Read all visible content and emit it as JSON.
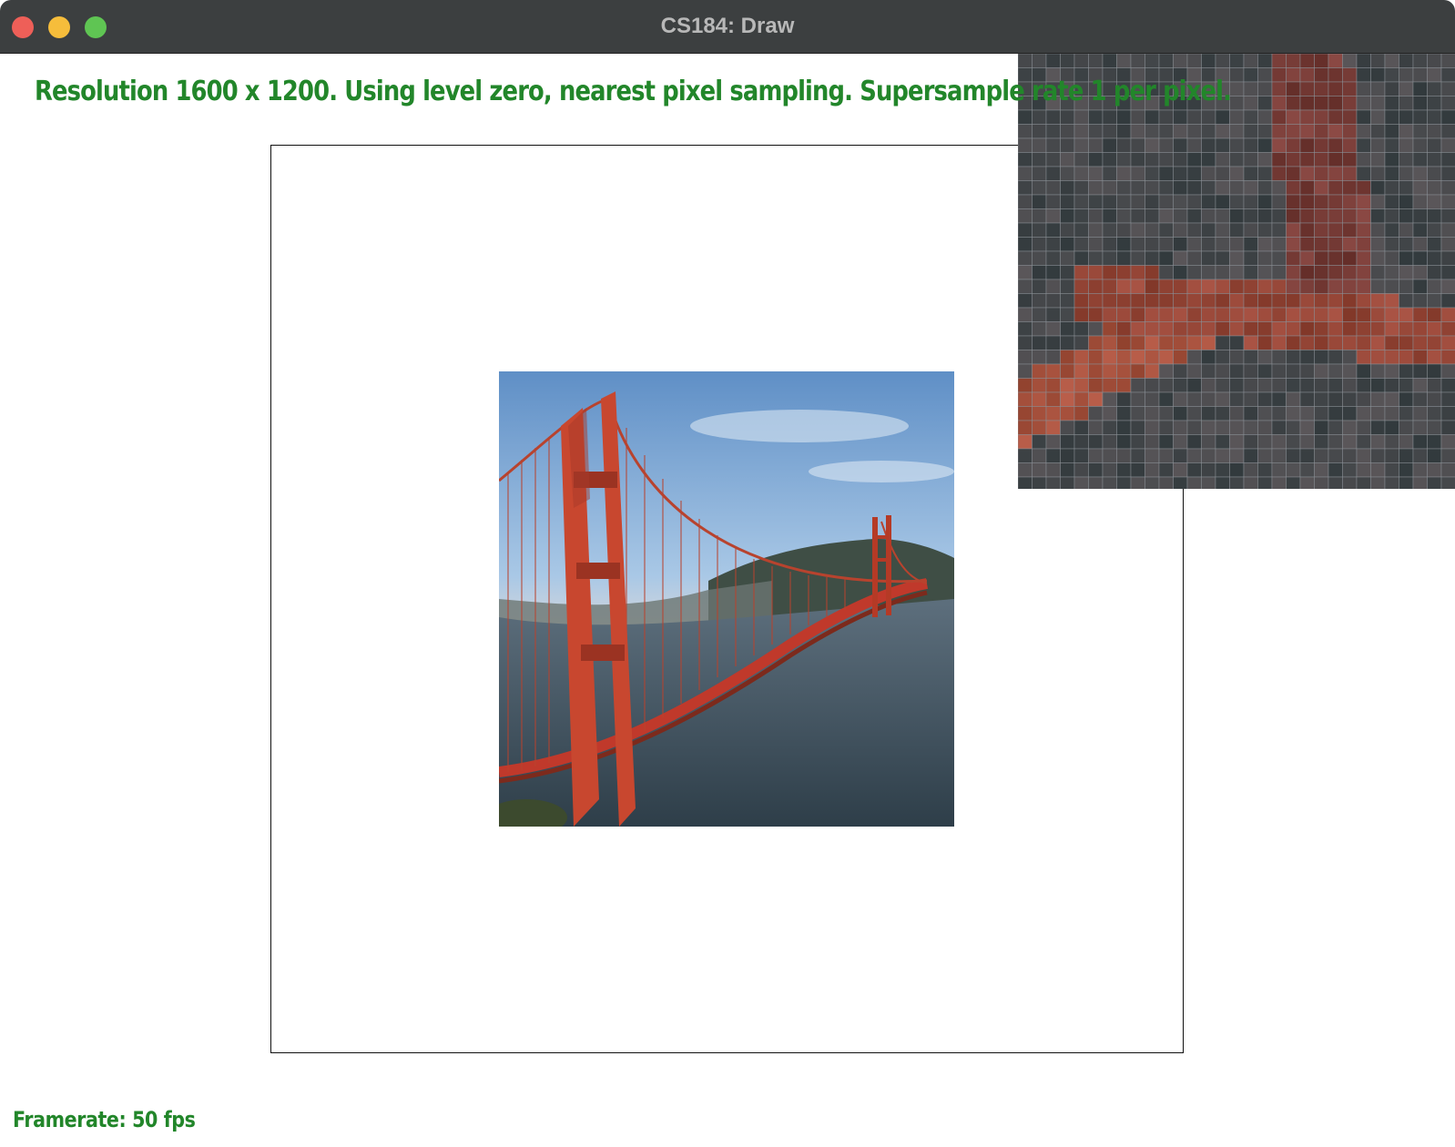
{
  "window": {
    "title": "CS184: Draw",
    "controls": [
      "close",
      "minimize",
      "maximize"
    ]
  },
  "overlay": {
    "status": "Resolution 1600 x 1200. Using level zero, nearest pixel sampling. Supersample rate 1 per pixel.",
    "framerate": "Framerate: 50 fps"
  },
  "colors": {
    "text_green": "#22862a",
    "titlebar": "#3c3f40"
  },
  "content": {
    "image": "golden-gate-bridge-photo",
    "zoom_view": "pixel-inspector-zoom"
  }
}
